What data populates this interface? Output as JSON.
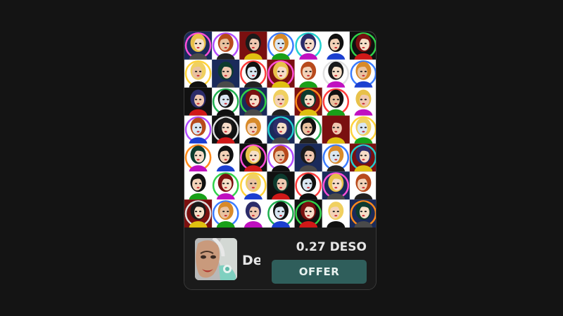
{
  "nft_card": {
    "title": "De",
    "price": "0.27 DESO",
    "offer_label": "OFFER",
    "image_name": "pinup-portrait-collage-image",
    "avatar_name": "creator-avatar",
    "colors": {
      "page_background": "#141414",
      "card_background": "#1b1b1b",
      "card_border": "#3a3a3a",
      "offer_button": "#2f5e5b",
      "text": "#e6e6e6"
    }
  }
}
